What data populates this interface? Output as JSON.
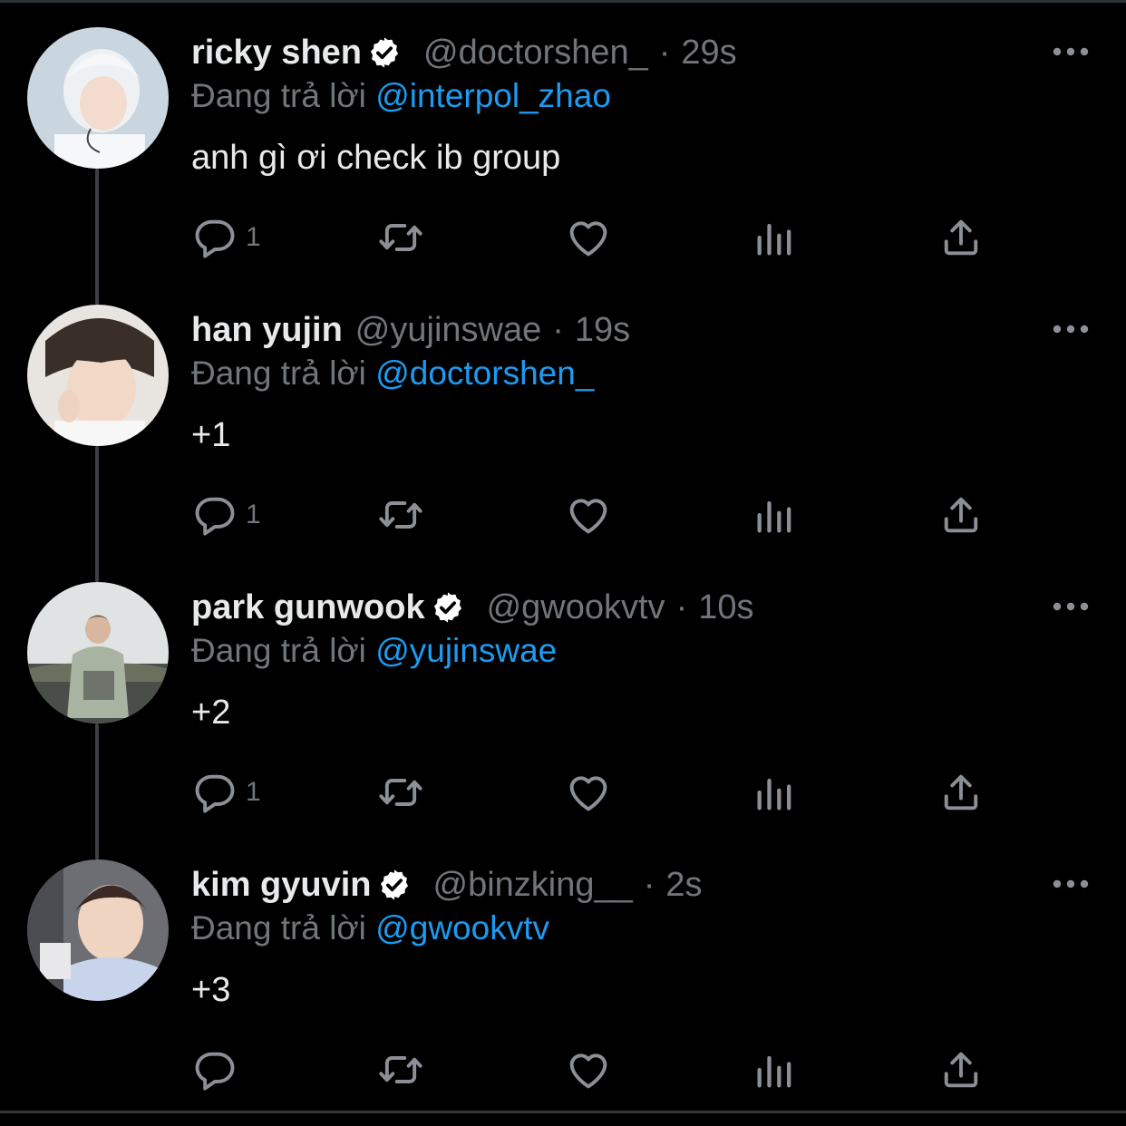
{
  "theme": {
    "background": "#000000",
    "text": "#e7e9ea",
    "muted": "#71767b",
    "accent": "#1d9bf0",
    "divider": "#2f3336"
  },
  "icons": {
    "more": "ellipsis-icon",
    "reply": "speech-bubble-icon",
    "retweet": "retweet-icon",
    "like": "heart-icon",
    "views": "bar-chart-icon",
    "share": "share-upload-icon",
    "verified": "verified-badge-icon"
  },
  "tweets": [
    {
      "name": "ricky shen",
      "verified": true,
      "handle": "@doctorshen_",
      "separator": "·",
      "time": "29s",
      "reply_prefix": "Đang trả lời",
      "reply_to": "@interpol_zhao",
      "text": "anh gì ơi check ib group",
      "reply_count": "1"
    },
    {
      "name": "han yujin",
      "verified": false,
      "handle": "@yujinswae",
      "separator": "·",
      "time": "19s",
      "reply_prefix": "Đang trả lời",
      "reply_to": "@doctorshen_",
      "text": "+1",
      "reply_count": "1"
    },
    {
      "name": "park gunwook",
      "verified": true,
      "handle": "@gwookvtv",
      "separator": "·",
      "time": "10s",
      "reply_prefix": "Đang trả lời",
      "reply_to": "@yujinswae",
      "text": "+2",
      "reply_count": "1"
    },
    {
      "name": "kim gyuvin",
      "verified": true,
      "handle": "@binzking__",
      "separator": "·",
      "time": "2s",
      "reply_prefix": "Đang trả lời",
      "reply_to": "@gwookvtv",
      "text": "+3",
      "reply_count": ""
    }
  ]
}
